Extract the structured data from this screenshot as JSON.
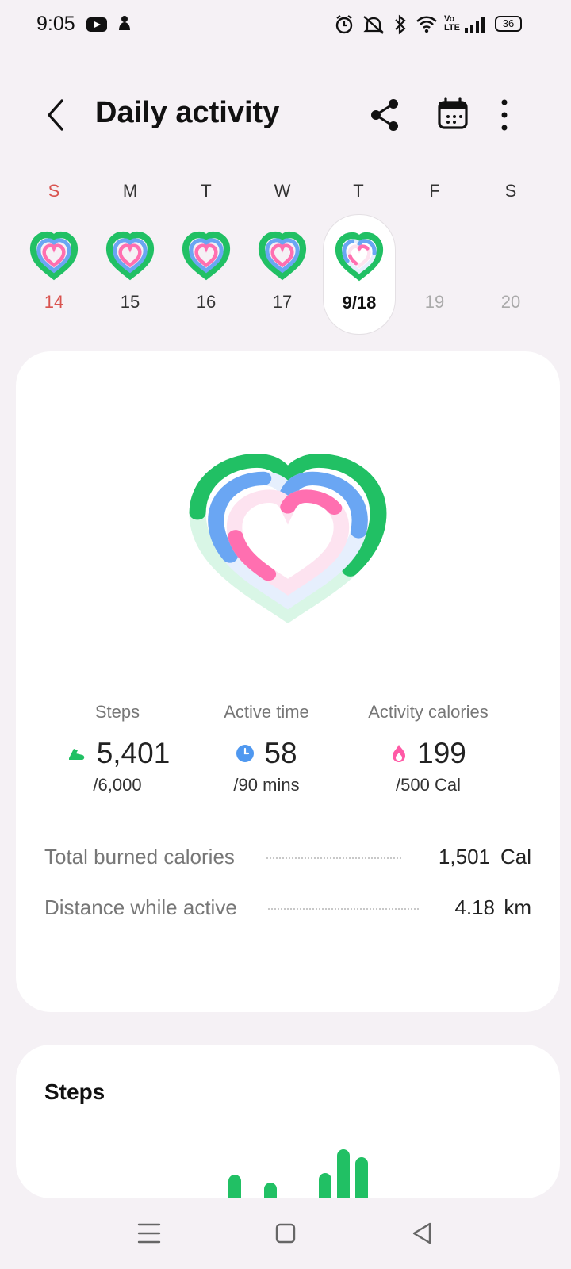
{
  "status_bar": {
    "time": "9:05",
    "icons": [
      "youtube-icon",
      "notification-icon",
      "alarm-icon",
      "mute-icon",
      "bluetooth-icon",
      "wifi-icon",
      "volte-icon",
      "signal-icon",
      "battery-icon"
    ],
    "volte_text": "Vo LTE",
    "battery": "36"
  },
  "header": {
    "title": "Daily activity",
    "icons": [
      "back-icon",
      "share-icon",
      "calendar-icon",
      "more-icon"
    ]
  },
  "week": [
    {
      "dow": "S",
      "num": "14",
      "state": "past"
    },
    {
      "dow": "M",
      "num": "15",
      "state": "past"
    },
    {
      "dow": "T",
      "num": "16",
      "state": "past"
    },
    {
      "dow": "W",
      "num": "17",
      "state": "past"
    },
    {
      "dow": "T",
      "num": "9/18",
      "state": "selected"
    },
    {
      "dow": "F",
      "num": "19",
      "state": "future"
    },
    {
      "dow": "S",
      "num": "20",
      "state": "future"
    }
  ],
  "activity": {
    "steps": {
      "label": "Steps",
      "value": "5,401",
      "goal": "/6,000",
      "progress": 0.9
    },
    "active_time": {
      "label": "Active time",
      "value": "58",
      "goal": "/90 mins",
      "progress": 0.64
    },
    "calories": {
      "label": "Activity calories",
      "value": "199",
      "goal": "/500 Cal",
      "progress": 0.4
    },
    "total_burned": {
      "label": "Total burned calories",
      "value": "1,501",
      "unit": "Cal"
    },
    "distance": {
      "label": "Distance while active",
      "value": "4.18",
      "unit": "km"
    }
  },
  "steps_card": {
    "title": "Steps",
    "bars": [
      0.3,
      0.2,
      0.32,
      0.62,
      0.52
    ]
  },
  "colors": {
    "green": "#21c064",
    "blue": "#6aa6f3",
    "pink": "#ff6fb0",
    "sunday_red": "#d9534f",
    "future_gray": "#aaaaaa"
  },
  "nav": {
    "icons": [
      "recent-apps-icon",
      "home-icon",
      "back-nav-icon"
    ]
  }
}
